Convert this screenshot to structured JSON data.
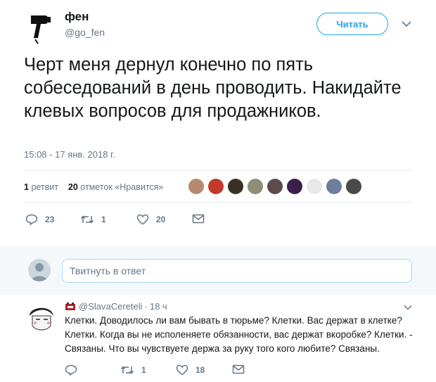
{
  "tweet": {
    "author_name": "фен",
    "author_handle": "@go_fen",
    "follow_label": "Читать",
    "text": "Черт меня дернул конечно по пять собеседований в день проводить. Накидайте клевых вопросов для продажников.",
    "timestamp": "15:08 - 17 янв. 2018 г.",
    "retweets_count": "1",
    "retweets_label": "ретвит",
    "likes_count": "20",
    "likes_label": "отметок «Нравится»",
    "actions": {
      "replies": "23",
      "retweets": "1",
      "likes": "20"
    }
  },
  "likers": [
    {
      "color": "#b58a6e",
      "icon": "avatar-image"
    },
    {
      "color": "#c0392b",
      "icon": "avatar-image"
    },
    {
      "color": "#3a3025",
      "icon": "avatar-image"
    },
    {
      "color": "#8e8e78",
      "icon": "avatar-image"
    },
    {
      "color": "#5d4a4a",
      "icon": "avatar-image"
    },
    {
      "color": "#3b1f4a",
      "icon": "avatar-image"
    },
    {
      "color": "#e8e8e8",
      "icon": "avatar-image"
    },
    {
      "color": "#6e7f9e",
      "icon": "avatar-image"
    },
    {
      "color": "#4a4a4a",
      "icon": "avatar-image"
    }
  ],
  "reply_box": {
    "placeholder": "Твитнуть в ответ"
  },
  "reply": {
    "author_handle": "@SlavaCereteli",
    "time": "18 ч",
    "text": "Клетки. Доводилось ли вам бывать в тюрьме? Клетки. Вас держат в клетке? Клетки. Когда вы не исполеняете обязанности, вас держат вкоробке? Клетки. - Связаны. Что вы чувствуете держа за руку того кого любите? Связаны.",
    "actions": {
      "retweets": "1",
      "likes": "18"
    }
  },
  "colors": {
    "accent": "#1da1f2",
    "muted": "#657786",
    "text": "#14171a",
    "divider": "#e6ecf0"
  }
}
